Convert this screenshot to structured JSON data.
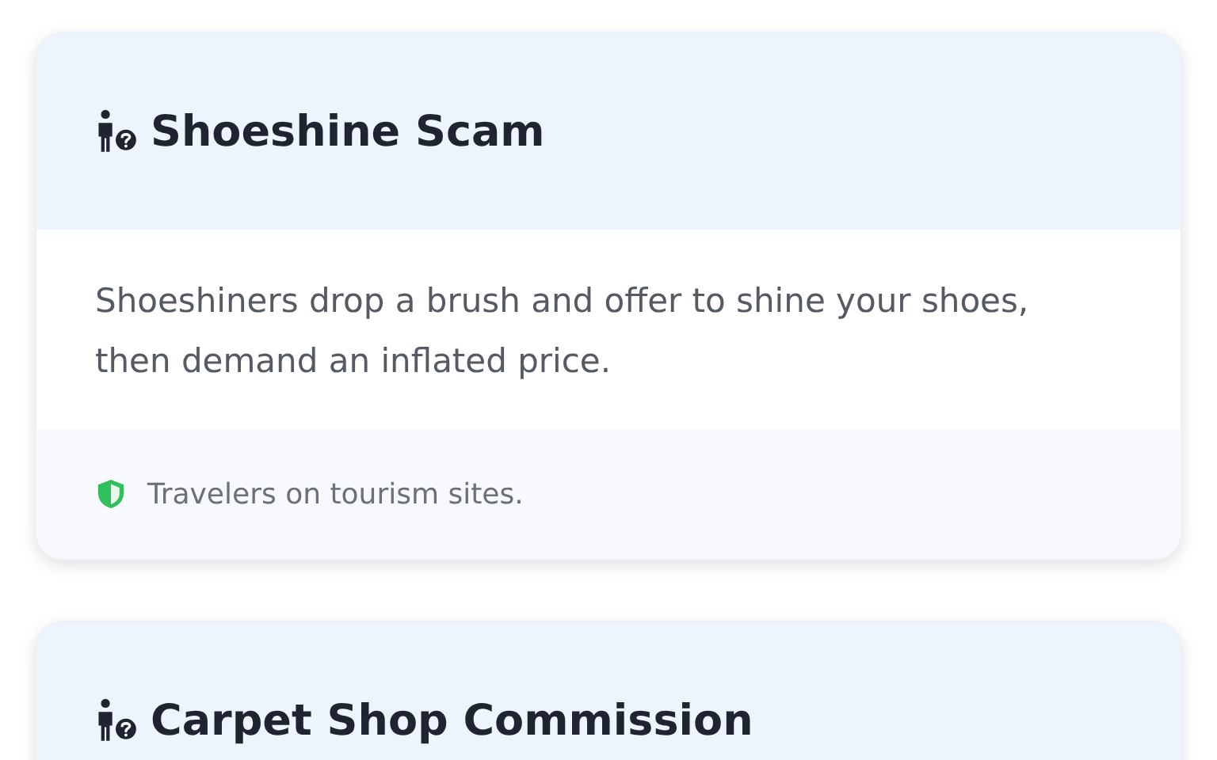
{
  "cards": [
    {
      "title": "Shoeshine Scam",
      "description": "Shoeshiners drop a brush and offer to shine your shoes, then demand an inflated price.",
      "target": "Travelers on tourism sites."
    },
    {
      "title": "Carpet Shop Commission"
    }
  ]
}
